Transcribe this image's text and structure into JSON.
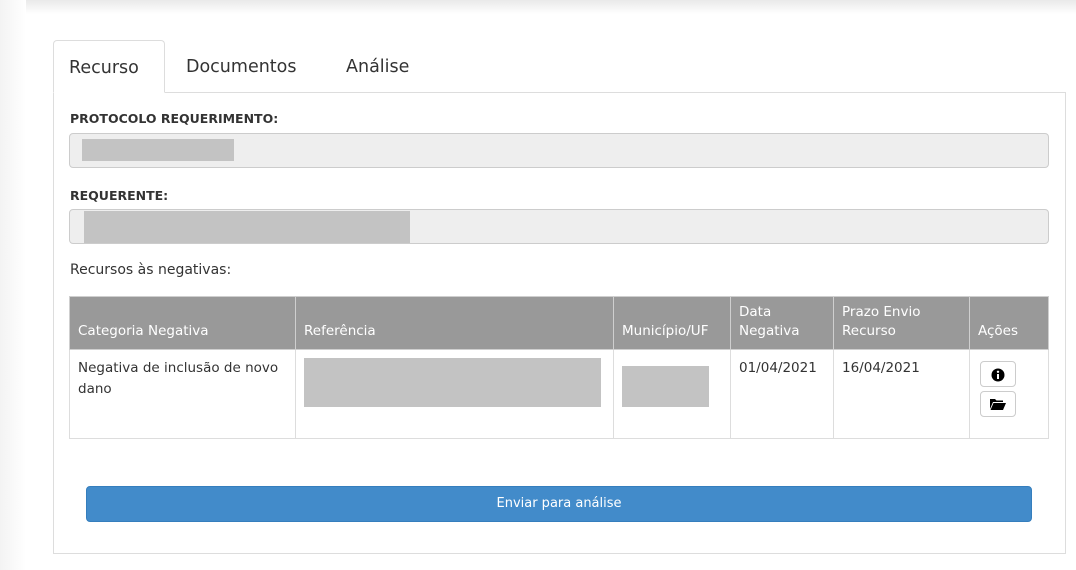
{
  "tabs": [
    {
      "label": "Recurso",
      "active": true
    },
    {
      "label": "Documentos",
      "active": false
    },
    {
      "label": "Análise",
      "active": false
    }
  ],
  "form": {
    "protocolo_label": "PROTOCOLO REQUERIMENTO:",
    "protocolo_value": "",
    "requerente_label": "REQUERENTE:",
    "requerente_value": ""
  },
  "recursos": {
    "subtitle": "Recursos às negativas:",
    "columns": [
      "Categoria Negativa",
      "Referência",
      "Município/UF",
      "Data Negativa",
      "Prazo Envio Recurso",
      "Ações"
    ],
    "rows": [
      {
        "categoria": "Negativa de inclusão de novo dano",
        "referencia": "",
        "municipio": "",
        "data_negativa": "01/04/2021",
        "prazo_envio": "16/04/2021",
        "actions": [
          "info-icon",
          "folder-open-icon"
        ]
      }
    ]
  },
  "submit_label": "Enviar para análise",
  "colors": {
    "primary": "#428bca",
    "header_bg": "#999999",
    "redaction": "#c3c3c3"
  }
}
